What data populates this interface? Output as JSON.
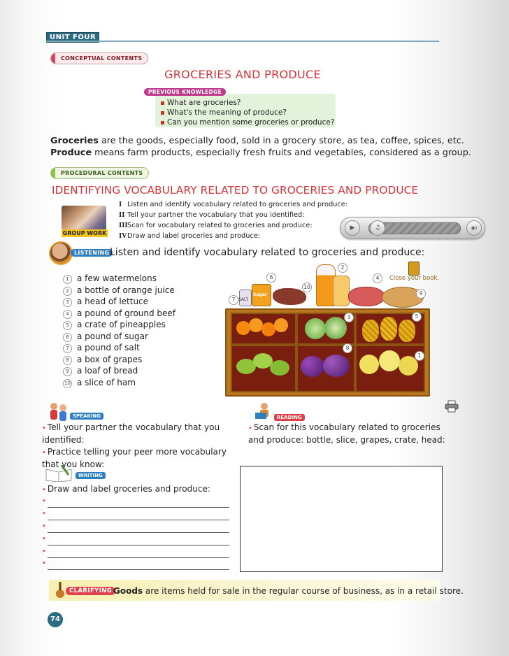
{
  "header": {
    "unit": "UNIT FOUR",
    "conceptual_label": "CONCEPTUAL CONTENTS"
  },
  "title": "GROCERIES AND PRODUCE",
  "previous_knowledge": {
    "label": "PREVIOUS KNOWLEDGE",
    "items": [
      "What are groceries?",
      "What's the meaning of produce?",
      "Can you mention some groceries or produce?"
    ]
  },
  "definitions": {
    "groceries_term": "Groceries",
    "groceries_text": " are the goods, especially food, sold in a grocery store, as tea, coffee, spices, etc.",
    "produce_term": "Produce",
    "produce_text": " means farm products, especially fresh fruits and vegetables, considered as a group."
  },
  "procedural_label": "PROCEDURAL CONTENTS",
  "section_title": "IDENTIFYING VOCABULARY RELATED TO GROCERIES AND PRODUCE",
  "group_work_label": "GROUP WORK",
  "steps": [
    {
      "roman": "I",
      "text": "Listen and identify vocabulary related to groceries and produce:"
    },
    {
      "roman": "II",
      "text": "Tell your partner the vocabulary that you identified:"
    },
    {
      "roman": "III",
      "text": "Scan for vocabulary related to groceries and produce:"
    },
    {
      "roman": "IV",
      "text": "Draw and label groceries and produce:"
    }
  ],
  "audio": {
    "play_icon": "play-icon",
    "note_icon": "music-note-icon",
    "volume_icon": "volume-icon",
    "play_glyph": "▶",
    "note_glyph": "♫",
    "volume_glyph": "◉)"
  },
  "listening": {
    "label": "LISTENING",
    "text": "Listen and identify vocabulary related to groceries and produce:"
  },
  "vocabulary": [
    {
      "n": "1",
      "text": "a few watermelons"
    },
    {
      "n": "2",
      "text": "a bottle of orange juice"
    },
    {
      "n": "3",
      "text": "a head of lettuce"
    },
    {
      "n": "4",
      "text": "a pound of ground beef"
    },
    {
      "n": "5",
      "text": "a crate of pineapples"
    },
    {
      "n": "6",
      "text": "a pound of sugar"
    },
    {
      "n": "7",
      "text": "a pound of salt"
    },
    {
      "n": "8",
      "text": "a box of grapes"
    },
    {
      "n": "9",
      "text": "a loaf of bread"
    },
    {
      "n": "10",
      "text": "a slice of ham"
    }
  ],
  "illustration": {
    "close_book": "Close your book.",
    "salt_label": "SALT",
    "sugar_label": "Sugar",
    "numbers": [
      "1",
      "2",
      "3",
      "4",
      "5",
      "6",
      "7",
      "8",
      "9",
      "10"
    ]
  },
  "speaking": {
    "label": "SPEAKING",
    "items": [
      "Tell your partner the vocabulary that you identified:",
      "Practice telling your peer more vocabulary that you know:"
    ]
  },
  "reading": {
    "label": "READING",
    "items": [
      "Scan for this vocabulary related to groceries and produce: bottle, slice, grapes, crate, head:"
    ]
  },
  "writing": {
    "label": "WRITING",
    "instruction": "Draw and label groceries and produce:",
    "bullet": "•"
  },
  "clarifying": {
    "label": "CLARIFYING",
    "term": "Goods",
    "text": " are items held for sale in the regular course of business, as in a retail store."
  },
  "page_number": "74"
}
